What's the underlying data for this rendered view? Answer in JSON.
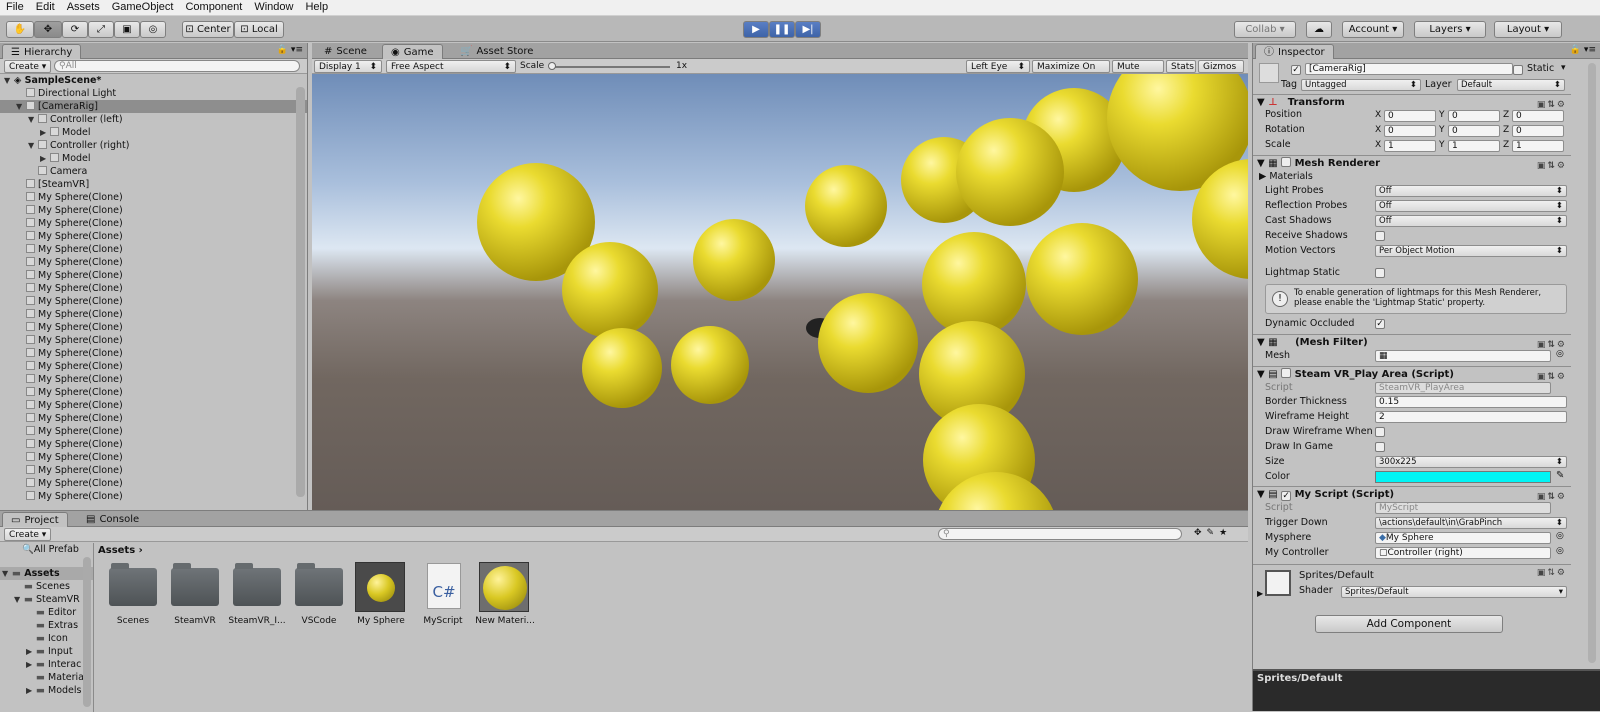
{
  "menu": [
    "File",
    "Edit",
    "Assets",
    "GameObject",
    "Component",
    "Window",
    "Help"
  ],
  "toolbar": {
    "pivot_center": "Center",
    "pivot_local": "Local",
    "collab": "Collab",
    "account": "Account",
    "layers": "Layers",
    "layout": "Layout"
  },
  "hierarchy": {
    "tab": "Hierarchy",
    "create": "Create",
    "search_placeholder": "All",
    "scene": "SampleScene*",
    "items": [
      {
        "label": "Directional Light",
        "indent": 1,
        "arrow": ""
      },
      {
        "label": "[CameraRig]",
        "indent": 1,
        "arrow": "▼",
        "selected": true
      },
      {
        "label": "Controller (left)",
        "indent": 2,
        "arrow": "▼"
      },
      {
        "label": "Model",
        "indent": 3,
        "arrow": "▶"
      },
      {
        "label": "Controller (right)",
        "indent": 2,
        "arrow": "▼"
      },
      {
        "label": "Model",
        "indent": 3,
        "arrow": "▶"
      },
      {
        "label": "Camera",
        "indent": 2,
        "arrow": ""
      },
      {
        "label": "[SteamVR]",
        "indent": 1,
        "arrow": ""
      },
      {
        "label": "My Sphere(Clone)",
        "indent": 1,
        "arrow": ""
      },
      {
        "label": "My Sphere(Clone)",
        "indent": 1,
        "arrow": ""
      },
      {
        "label": "My Sphere(Clone)",
        "indent": 1,
        "arrow": ""
      },
      {
        "label": "My Sphere(Clone)",
        "indent": 1,
        "arrow": ""
      },
      {
        "label": "My Sphere(Clone)",
        "indent": 1,
        "arrow": ""
      },
      {
        "label": "My Sphere(Clone)",
        "indent": 1,
        "arrow": ""
      },
      {
        "label": "My Sphere(Clone)",
        "indent": 1,
        "arrow": ""
      },
      {
        "label": "My Sphere(Clone)",
        "indent": 1,
        "arrow": ""
      },
      {
        "label": "My Sphere(Clone)",
        "indent": 1,
        "arrow": ""
      },
      {
        "label": "My Sphere(Clone)",
        "indent": 1,
        "arrow": ""
      },
      {
        "label": "My Sphere(Clone)",
        "indent": 1,
        "arrow": ""
      },
      {
        "label": "My Sphere(Clone)",
        "indent": 1,
        "arrow": ""
      },
      {
        "label": "My Sphere(Clone)",
        "indent": 1,
        "arrow": ""
      },
      {
        "label": "My Sphere(Clone)",
        "indent": 1,
        "arrow": ""
      },
      {
        "label": "My Sphere(Clone)",
        "indent": 1,
        "arrow": ""
      },
      {
        "label": "My Sphere(Clone)",
        "indent": 1,
        "arrow": ""
      },
      {
        "label": "My Sphere(Clone)",
        "indent": 1,
        "arrow": ""
      },
      {
        "label": "My Sphere(Clone)",
        "indent": 1,
        "arrow": ""
      },
      {
        "label": "My Sphere(Clone)",
        "indent": 1,
        "arrow": ""
      },
      {
        "label": "My Sphere(Clone)",
        "indent": 1,
        "arrow": ""
      },
      {
        "label": "My Sphere(Clone)",
        "indent": 1,
        "arrow": ""
      },
      {
        "label": "My Sphere(Clone)",
        "indent": 1,
        "arrow": ""
      },
      {
        "label": "My Sphere(Clone)",
        "indent": 1,
        "arrow": ""
      },
      {
        "label": "My Sphere(Clone)",
        "indent": 1,
        "arrow": ""
      }
    ]
  },
  "scene_tabs": {
    "scene": "Scene",
    "game": "Game",
    "asset_store": "Asset Store"
  },
  "game_bar": {
    "display": "Display 1",
    "aspect": "Free Aspect",
    "scale_label": "Scale",
    "scale_value": "1x",
    "left_eye": "Left Eye",
    "maximize": "Maximize On Play",
    "mute": "Mute Audio",
    "stats": "Stats",
    "gizmos": "Gizmos"
  },
  "project": {
    "tab_project": "Project",
    "tab_console": "Console",
    "create": "Create",
    "favorites": "All Prefab",
    "tree": [
      {
        "label": "Assets",
        "indent": 0,
        "arrow": "▼",
        "bold": true
      },
      {
        "label": "Scenes",
        "indent": 1,
        "arrow": ""
      },
      {
        "label": "SteamVR",
        "indent": 1,
        "arrow": "▼"
      },
      {
        "label": "Editor",
        "indent": 2,
        "arrow": ""
      },
      {
        "label": "Extras",
        "indent": 2,
        "arrow": ""
      },
      {
        "label": "Icon",
        "indent": 2,
        "arrow": ""
      },
      {
        "label": "Input",
        "indent": 2,
        "arrow": "▶"
      },
      {
        "label": "Interac",
        "indent": 2,
        "arrow": "▶"
      },
      {
        "label": "Materia",
        "indent": 2,
        "arrow": ""
      },
      {
        "label": "Models",
        "indent": 2,
        "arrow": "▶"
      }
    ],
    "breadcrumb": "Assets",
    "assets": [
      {
        "label": "Scenes",
        "kind": "folder"
      },
      {
        "label": "SteamVR",
        "kind": "folder"
      },
      {
        "label": "SteamVR_I...",
        "kind": "folder"
      },
      {
        "label": "VSCode",
        "kind": "folder"
      },
      {
        "label": "My Sphere",
        "kind": "prefab"
      },
      {
        "label": "MyScript",
        "kind": "script"
      },
      {
        "label": "New Materi...",
        "kind": "material"
      }
    ],
    "script_glyph": "C#"
  },
  "inspector": {
    "tab": "Inspector",
    "object_name": "[CameraRig]",
    "static_label": "Static",
    "tag_label": "Tag",
    "tag_value": "Untagged",
    "layer_label": "Layer",
    "layer_value": "Default",
    "transform": {
      "title": "Transform",
      "position_label": "Position",
      "rotation_label": "Rotation",
      "scale_label": "Scale",
      "position": [
        "0",
        "0",
        "0"
      ],
      "rotation": [
        "0",
        "0",
        "0"
      ],
      "scale": [
        "1",
        "1",
        "1"
      ]
    },
    "mesh_renderer": {
      "title": "Mesh Renderer",
      "materials": "Materials",
      "light_probes": "Light Probes",
      "light_probes_val": "Off",
      "reflection_probes": "Reflection Probes",
      "reflection_probes_val": "Off",
      "cast_shadows": "Cast Shadows",
      "cast_shadows_val": "Off",
      "receive_shadows": "Receive Shadows",
      "motion_vectors": "Motion Vectors",
      "motion_vectors_val": "Per Object Motion",
      "lightmap_static": "Lightmap Static",
      "info": "To enable generation of lightmaps for this Mesh Renderer, please enable the 'Lightmap Static' property.",
      "dynamic_occluded": "Dynamic Occluded"
    },
    "mesh_filter": {
      "title": "(Mesh Filter)",
      "mesh_label": "Mesh"
    },
    "play_area": {
      "title": "Steam VR_Play Area (Script)",
      "script_label": "Script",
      "script_value": "SteamVR_PlayArea",
      "border_label": "Border Thickness",
      "border_value": "0.15",
      "wire_height_label": "Wireframe Height",
      "wire_height_value": "2",
      "draw_wire_label": "Draw Wireframe When",
      "draw_game_label": "Draw In Game",
      "size_label": "Size",
      "size_value": "300x225",
      "color_label": "Color",
      "color_value": "#00f5f5"
    },
    "my_script": {
      "title": "My Script (Script)",
      "script_label": "Script",
      "script_value": "MyScript",
      "trigger_label": "Trigger Down",
      "trigger_value": "\\actions\\default\\in\\GrabPinch",
      "sphere_label": "Mysphere",
      "sphere_value": "My Sphere",
      "controller_label": "My Controller",
      "controller_value": "Controller (right)"
    },
    "material": {
      "name": "Sprites/Default",
      "shader_label": "Shader",
      "shader_value": "Sprites/Default"
    },
    "add_component": "Add Component",
    "preview_title": "Sprites/Default"
  },
  "colors": {
    "accent": "#3e63a8",
    "sphere": "#e0d12a",
    "cyan": "#00f5f5"
  }
}
